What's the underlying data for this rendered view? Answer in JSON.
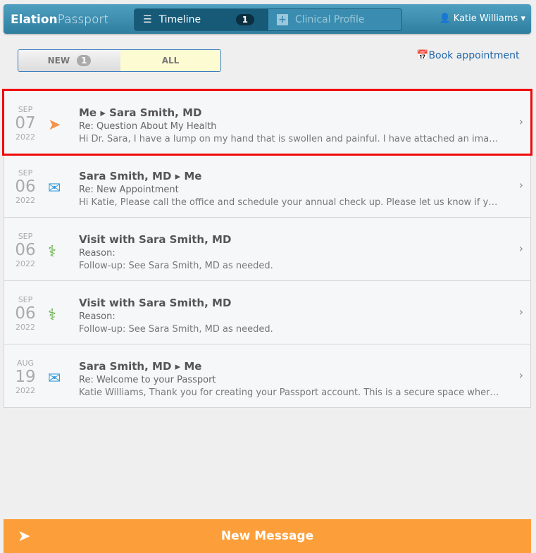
{
  "nav": {
    "logo_bold": "Elation",
    "logo_light": "Passport",
    "tab_timeline": "Timeline",
    "timeline_badge": "1",
    "tab_clinical": "Clinical Profile",
    "user": "Katie Williams"
  },
  "filter": {
    "new": "NEW",
    "new_count": "1",
    "all": "ALL"
  },
  "book": "Book appointment",
  "items": [
    {
      "month": "SEP",
      "day": "07",
      "year": "2022",
      "icon": "paper-plane-icon",
      "title": "Me ▸ Sara Smith, MD",
      "subject": "Re: Question About My Health",
      "preview": "Hi Dr. Sara, I have a lump on my hand that is swollen and painful. I have attached an image ...",
      "selected": true
    },
    {
      "month": "SEP",
      "day": "06",
      "year": "2022",
      "icon": "envelope-icon",
      "title": "Sara Smith, MD ▸ Me",
      "subject": "Re: New Appointment",
      "preview": "Hi Katie, Please call the office and schedule your annual check up. Please let us know if you ..."
    },
    {
      "month": "SEP",
      "day": "06",
      "year": "2022",
      "icon": "stethoscope-icon",
      "title": "Visit with Sara Smith, MD",
      "subject": "Reason:",
      "preview": "Follow-up: See Sara Smith, MD as needed."
    },
    {
      "month": "SEP",
      "day": "06",
      "year": "2022",
      "icon": "stethoscope-icon",
      "title": "Visit with Sara Smith, MD",
      "subject": "Reason:",
      "preview": "Follow-up: See Sara Smith, MD as needed."
    },
    {
      "month": "AUG",
      "day": "19",
      "year": "2022",
      "icon": "envelope-icon",
      "title": "Sara Smith, MD ▸ Me",
      "subject": "Re: Welcome to your Passport",
      "preview": "Katie Williams, Thank you for creating your Passport account. This is a secure space where ..."
    }
  ],
  "new_message": "New Message"
}
